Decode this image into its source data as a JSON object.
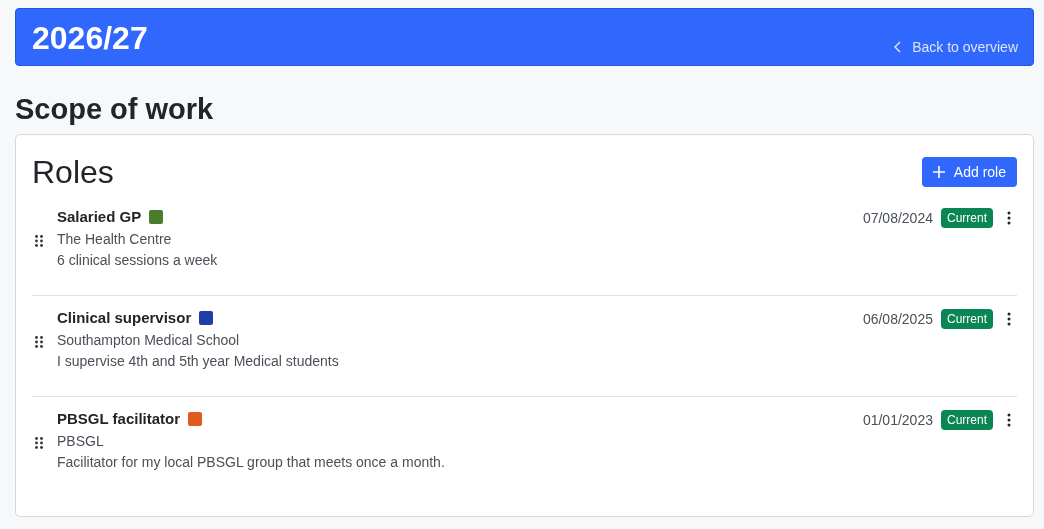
{
  "header": {
    "title": "2026/27",
    "back_link": "Back to overview"
  },
  "page_title": "Scope of work",
  "card": {
    "title": "Roles",
    "add_button": "Add role",
    "roles": [
      {
        "title": "Salaried GP",
        "color": "#4a7c2a",
        "organisation": "The Health Centre",
        "description": "6 clinical sessions a week",
        "date": "07/08/2024",
        "status": "Current"
      },
      {
        "title": "Clinical supervisor",
        "color": "#1f3ea8",
        "organisation": "Southampton Medical School",
        "description": "I supervise 4th and 5th year Medical students",
        "date": "06/08/2025",
        "status": "Current"
      },
      {
        "title": "PBSGL facilitator",
        "color": "#e05a1a",
        "organisation": "PBSGL",
        "description": "Facilitator for my local PBSGL group that meets once a month.",
        "date": "01/01/2023",
        "status": "Current"
      }
    ]
  }
}
